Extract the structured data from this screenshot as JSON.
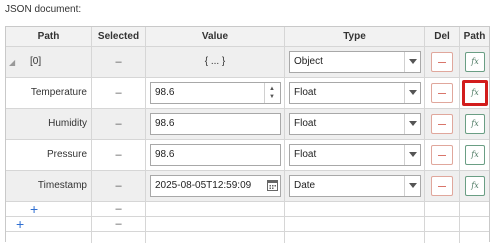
{
  "doc_label": "JSON document:",
  "columns": {
    "path": "Path",
    "selected": "Selected",
    "value": "Value",
    "type": "Type",
    "del": "Del",
    "path2": "Path"
  },
  "object_row": {
    "key": "[0]",
    "selected": "–",
    "value": "{ ... }",
    "type": "Object",
    "fx": "fx"
  },
  "rows": [
    {
      "key": "Temperature",
      "selected": "–",
      "value": "98.6",
      "type": "Float",
      "fx": "fx"
    },
    {
      "key": "Humidity",
      "selected": "–",
      "value": "98.6",
      "type": "Float",
      "fx": "fx"
    },
    {
      "key": "Pressure",
      "selected": "–",
      "value": "98.6",
      "type": "Float",
      "fx": "fx"
    },
    {
      "key": "Timestamp",
      "selected": "–",
      "value": "2025-08-05T12:59:09",
      "type": "Date",
      "fx": "fx"
    }
  ],
  "add_rows": [
    {
      "symbol": "+",
      "selected": "–"
    },
    {
      "symbol": "+",
      "selected": "–"
    }
  ],
  "colors": {
    "selected_outline": "#d21c1c",
    "add_plus": "#2f6fd1",
    "delete_border": "#e0a79c",
    "fx_border": "#6a9e84"
  },
  "icons": {
    "expand": "collapse-triangle-icon",
    "spinner": "spinner-arrows-icon",
    "calendar": "calendar-icon",
    "dropdown": "chevron-down-icon",
    "delete": "minus-icon",
    "path": "fx-icon",
    "add": "plus-icon"
  }
}
